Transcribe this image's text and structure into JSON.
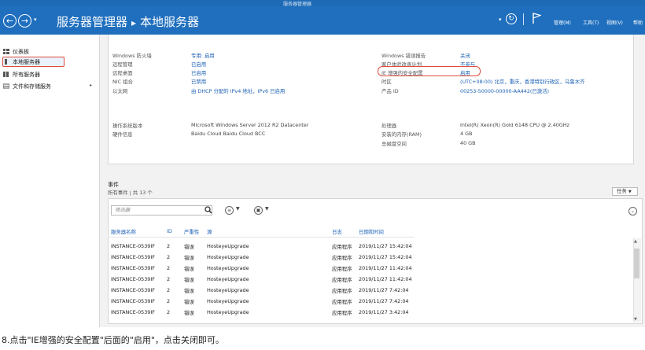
{
  "window": {
    "title": "服务器管理器"
  },
  "header": {
    "breadcrumb_root": "服务器管理器",
    "breadcrumb_sep": "▸",
    "breadcrumb_current": "本地服务器",
    "menu": [
      "管理(M)",
      "工具(T)",
      "视图(V)",
      "帮助"
    ]
  },
  "sidebar": {
    "items": [
      "仪表板",
      "本地服务器",
      "所有服务器",
      "文件和存储服务"
    ]
  },
  "properties": {
    "left": [
      {
        "label": "Windows 防火墙",
        "value": "专用: 启用"
      },
      {
        "label": "远程管理",
        "value": "已启用"
      },
      {
        "label": "远程桌面",
        "value": "已启用"
      },
      {
        "label": "NIC 组合",
        "value": "已禁用"
      },
      {
        "label": "以太网",
        "value": "由 DHCP 分配的 IPv4 地址，IPv6 已启用"
      }
    ],
    "right": [
      {
        "label": "Windows 错误报告",
        "value": "关闭"
      },
      {
        "label": "客户体验改善计划",
        "value": "不参与"
      },
      {
        "label": "IE 增强的安全配置",
        "value": "启用"
      },
      {
        "label": "时区",
        "value": "(UTC+08:00) 北京，重庆，香港特别行政区，乌鲁木齐"
      },
      {
        "label": "产品 ID",
        "value": "00253-50000-00000-AA442(已激活)"
      }
    ],
    "os": {
      "label": "操作系统版本",
      "value": "Microsoft Windows Server 2012 R2 Datacenter"
    },
    "hw": {
      "label": "硬件信息",
      "value": "Baidu Cloud Baidu Cloud BCC"
    },
    "cpu": {
      "label": "处理器",
      "value": "Intel(R) Xeon(R) Gold 6148 CPU @ 2.40GHz"
    },
    "ram": {
      "label": "安装的内存(RAM)",
      "value": "4 GB"
    },
    "disk": {
      "label": "总磁盘空间",
      "value": "40 GB"
    }
  },
  "events": {
    "title": "事件",
    "subtitle": "所有事件 | 共 13 个",
    "tasks_label": "任务",
    "filter_placeholder": "筛选器",
    "columns": [
      "服务器名称",
      "ID",
      "严重性",
      "源",
      "日志",
      "日期和时间"
    ],
    "rows": [
      [
        "INSTANCE-0539IF",
        "2",
        "错误",
        "HosteyeUpgrade",
        "应用程序",
        "2019/11/27 15:42:04"
      ],
      [
        "INSTANCE-0539IF",
        "2",
        "错误",
        "HosteyeUpgrade",
        "应用程序",
        "2019/11/27 15:42:04"
      ],
      [
        "INSTANCE-0539IF",
        "2",
        "错误",
        "HosteyeUpgrade",
        "应用程序",
        "2019/11/27 11:42:04"
      ],
      [
        "INSTANCE-0539IF",
        "2",
        "错误",
        "HosteyeUpgrade",
        "应用程序",
        "2019/11/27 11:42:04"
      ],
      [
        "INSTANCE-0539IF",
        "2",
        "错误",
        "HosteyeUpgrade",
        "应用程序",
        "2019/11/27 7:42:04"
      ],
      [
        "INSTANCE-0539IF",
        "2",
        "错误",
        "HosteyeUpgrade",
        "应用程序",
        "2019/11/27 7:42:04"
      ],
      [
        "INSTANCE-0539IF",
        "2",
        "错误",
        "HosteyeUpgrade",
        "应用程序",
        "2019/11/27 3:42:04"
      ]
    ]
  },
  "caption": "8.点击\"IE增强的安全配置\"后面的\"启用\"，点击关闭即可。",
  "colors": {
    "header_blue": "#1f6fbe",
    "highlight_red": "#e04a3c",
    "link_blue": "#1c62b5"
  }
}
